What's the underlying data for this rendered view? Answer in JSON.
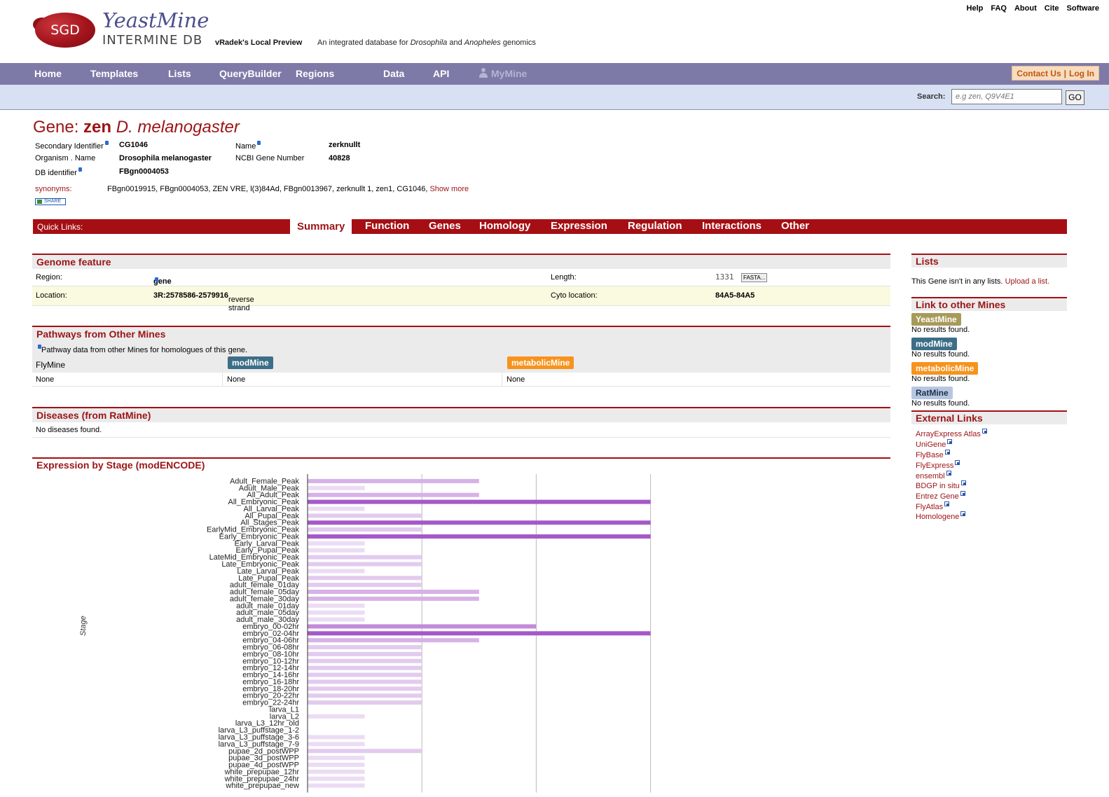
{
  "header": {
    "logo_text": "SGD",
    "brand": "YeastMine",
    "brand_sub": "INTERMINE DB",
    "project_title": "vRadek's Local Preview",
    "project_subtitle_parts": [
      "An integrated database for ",
      "Drosophila",
      " and ",
      "Anopheles",
      " genomics"
    ],
    "top_links": [
      "Help",
      "FAQ",
      "About",
      "Cite",
      "Software"
    ]
  },
  "menu": {
    "items": [
      "Home",
      "Templates",
      "Lists",
      "QueryBuilder",
      "Regions",
      "Data",
      "API"
    ],
    "mymine": "MyMine",
    "contact": "Contact Us",
    "login": "Log In"
  },
  "search": {
    "label": "Search:",
    "placeholder": "e.g zen, Q9V4E1",
    "button": "GO"
  },
  "gene": {
    "title_prefix": "Gene: ",
    "symbol": "zen",
    "organism": "D. melanogaster",
    "summary": [
      {
        "label": "Secondary Identifier",
        "value": "CG1046",
        "info": true
      },
      {
        "label": "Name",
        "value": "zerknullt",
        "info": true
      },
      {
        "label": "Organism . Name",
        "value": "Drosophila melanogaster",
        "info": false
      },
      {
        "label": "NCBI Gene Number",
        "value": "40828",
        "info": false
      },
      {
        "label": "DB identifier",
        "value": "FBgn0004053",
        "info": true
      }
    ],
    "synonyms_label": "synonyms:",
    "synonyms": "FBgn0019915, FBgn0004053, ZEN VRE, l(3)84Ad, FBgn0013967, zerknullt 1, zen1, CG1046,",
    "show_more": "Show more",
    "share": "SHARE"
  },
  "quicklinks": {
    "label": "Quick Links:",
    "tabs": [
      "Summary",
      "Function",
      "Genes",
      "Homology",
      "Expression",
      "Regulation",
      "Interactions",
      "Other"
    ]
  },
  "genome_feature": {
    "title": "Genome feature",
    "region_label": "Region:",
    "region": "gene",
    "length_label": "Length:",
    "length": "1331",
    "fasta": "FASTA...",
    "location_label": "Location:",
    "location": "3R:2578586-2579916",
    "strand": "reverse strand",
    "cyto_label": "Cyto location:",
    "cyto": "84A5-84A5"
  },
  "pathways": {
    "title": "Pathways from Other Mines",
    "note": "Pathway data from other Mines for homologues of this gene.",
    "columns": [
      {
        "name": "FlyMine",
        "value": "None",
        "color": ""
      },
      {
        "name": "modMine",
        "value": "None",
        "color": "#3c6e87"
      },
      {
        "name": "metabolicMine",
        "value": "None",
        "color": "#f7931d"
      }
    ]
  },
  "diseases": {
    "title": "Diseases (from RatMine)",
    "text": "No diseases found."
  },
  "expression": {
    "title": "Expression by Stage (modENCODE)",
    "ylabel": "Stage"
  },
  "chart_data": {
    "type": "bar",
    "orientation": "horizontal",
    "ylabel": "Stage",
    "xlim": [
      0,
      6
    ],
    "grid": true,
    "categories": [
      "Adult_Female_Peak",
      "Adult_Male_Peak",
      "All_Adult_Peak",
      "All_Embryonic_Peak",
      "All_Larval_Peak",
      "All_Pupal_Peak",
      "All_Stages_Peak",
      "EarlyMid_Embryonic_Peak",
      "Early_Embryonic_Peak",
      "Early_Larval_Peak",
      "Early_Pupal_Peak",
      "LateMid_Embryonic_Peak",
      "Late_Embryonic_Peak",
      "Late_Larval_Peak",
      "Late_Pupal_Peak",
      "adult_female_01day",
      "adult_female_05day",
      "adult_female_30day",
      "adult_male_01day",
      "adult_male_05day",
      "adult_male_30day",
      "embryo_00-02hr",
      "embryo_02-04hr",
      "embryo_04-06hr",
      "embryo_06-08hr",
      "embryo_08-10hr",
      "embryo_10-12hr",
      "embryo_12-14hr",
      "embryo_14-16hr",
      "embryo_16-18hr",
      "embryo_18-20hr",
      "embryo_20-22hr",
      "embryo_22-24hr",
      "larva_L1",
      "larva_L2",
      "larva_L3_12hr_old",
      "larva_L3_puffstage_1-2",
      "larva_L3_puffstage_3-6",
      "larva_L3_puffstage_7-9",
      "pupae_2d_postWPP",
      "pupae_3d_postWPP",
      "pupae_4d_postWPP",
      "white_prepupae_12hr",
      "white_prepupae_24hr",
      "white_prepupae_new"
    ],
    "values": [
      3,
      1,
      3,
      6,
      1,
      2,
      6,
      2,
      6,
      1,
      1,
      2,
      2,
      1,
      2,
      2,
      3,
      3,
      1,
      1,
      1,
      4,
      6,
      3,
      2,
      2,
      2,
      2,
      2,
      2,
      2,
      2,
      2,
      0,
      1,
      0,
      0,
      1,
      1,
      2,
      1,
      1,
      1,
      1,
      1
    ],
    "colors": {
      "1": "#ecdcf3",
      "2": "#e2cbee",
      "3": "#d6b2e6",
      "4": "#c38ad9",
      "6": "#a559c9"
    }
  },
  "sidebar": {
    "lists_title": "Lists",
    "lists_text": "This Gene isn't in any lists.",
    "lists_link": "Upload a list.",
    "mines_title": "Link to other Mines",
    "mines": [
      {
        "name": "YeastMine",
        "text": "No results found.",
        "color": "#a89a59"
      },
      {
        "name": "modMine",
        "text": "No results found.",
        "color": "#3c6e87"
      },
      {
        "name": "metabolicMine",
        "text": "No results found.",
        "color": "#f7931d"
      },
      {
        "name": "RatMine",
        "text": "No results found.",
        "color": "#b7c7e2"
      }
    ],
    "external_title": "External Links",
    "external": [
      "ArrayExpress Atlas",
      "UniGene",
      "FlyBase",
      "FlyExpress",
      "ensembl",
      "BDGP in situ",
      "Entrez Gene",
      "FlyAtlas",
      "Homologene"
    ]
  }
}
